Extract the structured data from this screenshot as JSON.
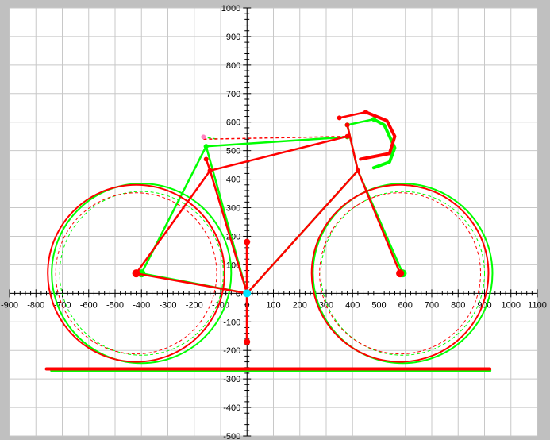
{
  "chart_data": {
    "type": "line",
    "title": "",
    "xlabel": "",
    "ylabel": "",
    "xlim": [
      -900,
      1100
    ],
    "ylim": [
      -500,
      1000
    ],
    "grid": true,
    "x_ticks": [
      -900,
      -800,
      -700,
      -600,
      -500,
      -400,
      -300,
      -200,
      -100,
      0,
      100,
      200,
      300,
      400,
      500,
      600,
      700,
      800,
      900,
      1000,
      1100
    ],
    "y_ticks": [
      -500,
      -400,
      -300,
      -200,
      -100,
      0,
      100,
      200,
      300,
      400,
      500,
      600,
      700,
      800,
      900,
      1000
    ],
    "colors": {
      "green": "#00ff00",
      "red": "#ff0000",
      "cyan": "#00e5ff",
      "pink": "#ff80c0",
      "plot_bg": "#ffffff",
      "grid": "#c8c8c8"
    },
    "geometries": [
      {
        "color": "green",
        "wheels": [
          {
            "center": [
              -400,
              70
            ],
            "outer_radius": 340,
            "inner_radius": 310
          },
          {
            "center": [
              590,
              70
            ],
            "outer_radius": 340,
            "inner_radius": 310
          }
        ],
        "ground": [
          [
            -740,
            -270
          ],
          [
            920,
            -270
          ]
        ],
        "seat_tube": [
          [
            0,
            0
          ],
          [
            -155,
            515
          ]
        ],
        "top_tube": [
          [
            -155,
            515
          ],
          [
            380,
            548
          ]
        ],
        "down_tube": [
          [
            0,
            0
          ],
          [
            420,
            430
          ]
        ],
        "head_tube": [
          [
            380,
            590
          ],
          [
            420,
            430
          ]
        ],
        "chainstay": [
          [
            0,
            0
          ],
          [
            -400,
            70
          ]
        ],
        "seatstay": [
          [
            -155,
            515
          ],
          [
            -400,
            70
          ]
        ],
        "fork": [
          [
            420,
            430
          ],
          [
            590,
            70
          ]
        ],
        "stem": [
          [
            380,
            590
          ],
          [
            480,
            610
          ]
        ],
        "handlebar": [
          [
            480,
            610
          ],
          [
            520,
            590
          ],
          [
            560,
            510
          ],
          [
            540,
            460
          ],
          [
            480,
            440
          ]
        ],
        "saddle": [
          [
            -170,
            548
          ],
          [
            -110,
            540
          ]
        ]
      },
      {
        "color": "red",
        "wheels": [
          {
            "center": [
              -420,
              70
            ],
            "outer_radius": 335,
            "inner_radius": 305
          },
          {
            "center": [
              580,
              70
            ],
            "outer_radius": 335,
            "inner_radius": 305
          }
        ],
        "ground": [
          [
            -760,
            -265
          ],
          [
            920,
            -265
          ]
        ],
        "seat_tube": [
          [
            0,
            0
          ],
          [
            -140,
            430
          ]
        ],
        "top_tube": [
          [
            -140,
            430
          ],
          [
            380,
            550
          ]
        ],
        "down_tube": [
          [
            0,
            0
          ],
          [
            420,
            430
          ]
        ],
        "head_tube": [
          [
            380,
            590
          ],
          [
            420,
            430
          ]
        ],
        "chainstay": [
          [
            0,
            0
          ],
          [
            -420,
            70
          ]
        ],
        "seatstay": [
          [
            -140,
            430
          ],
          [
            -420,
            70
          ]
        ],
        "fork": [
          [
            420,
            430
          ],
          [
            580,
            70
          ]
        ],
        "stem": [
          [
            350,
            615
          ],
          [
            450,
            635
          ]
        ],
        "handlebar": [
          [
            450,
            635
          ],
          [
            530,
            605
          ],
          [
            560,
            550
          ],
          [
            540,
            490
          ],
          [
            430,
            470
          ]
        ],
        "saddle": [
          [
            -165,
            540
          ],
          [
            380,
            550
          ]
        ],
        "crank": [
          [
            0,
            180
          ],
          [
            0,
            -170
          ]
        ],
        "seatpost": [
          [
            -140,
            430
          ],
          [
            -155,
            470
          ]
        ]
      }
    ]
  }
}
